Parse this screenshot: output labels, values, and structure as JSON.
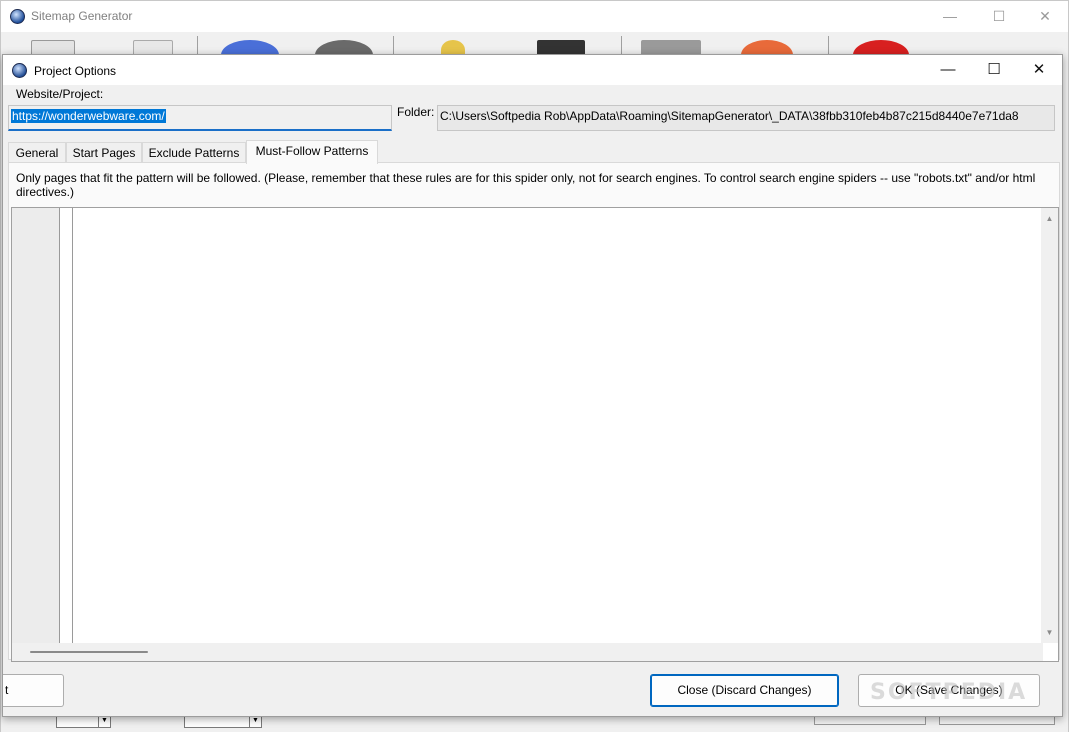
{
  "main_window": {
    "title": "Sitemap Generator",
    "controls": {
      "minimize": "—",
      "maximize": "☐",
      "close": "✕"
    }
  },
  "dialog": {
    "title": "Project Options",
    "controls": {
      "minimize": "—",
      "maximize": "☐",
      "close": "✕"
    },
    "website_label": "Website/Project:",
    "website_value": "https://wonderwebware.com/",
    "folder_label": "Folder:",
    "folder_value": "C:\\Users\\Softpedia Rob\\AppData\\Roaming\\SitemapGenerator\\_DATA\\38fbb310feb4b87c215d8440e7e71da8",
    "tabs": [
      {
        "label": "General",
        "active": false
      },
      {
        "label": "Start Pages",
        "active": false
      },
      {
        "label": "Exclude Patterns",
        "active": false
      },
      {
        "label": "Must-Follow Patterns",
        "active": true
      }
    ],
    "description": "Only pages that fit the pattern will be followed. (Please, remember that these rules are for this spider only, not for search engines. To control search engine spiders -- use \"robots.txt\" and/or html directives.)",
    "editor_text": "",
    "scroll_up_glyph": "▲",
    "scroll_down_glyph": "▼",
    "left_button_fragment": "t",
    "close_button": "Close (Discard Changes)",
    "ok_button": "OK (Save Changes)"
  },
  "watermark": "SOFTPEDIA",
  "combo_arrow": "▼"
}
